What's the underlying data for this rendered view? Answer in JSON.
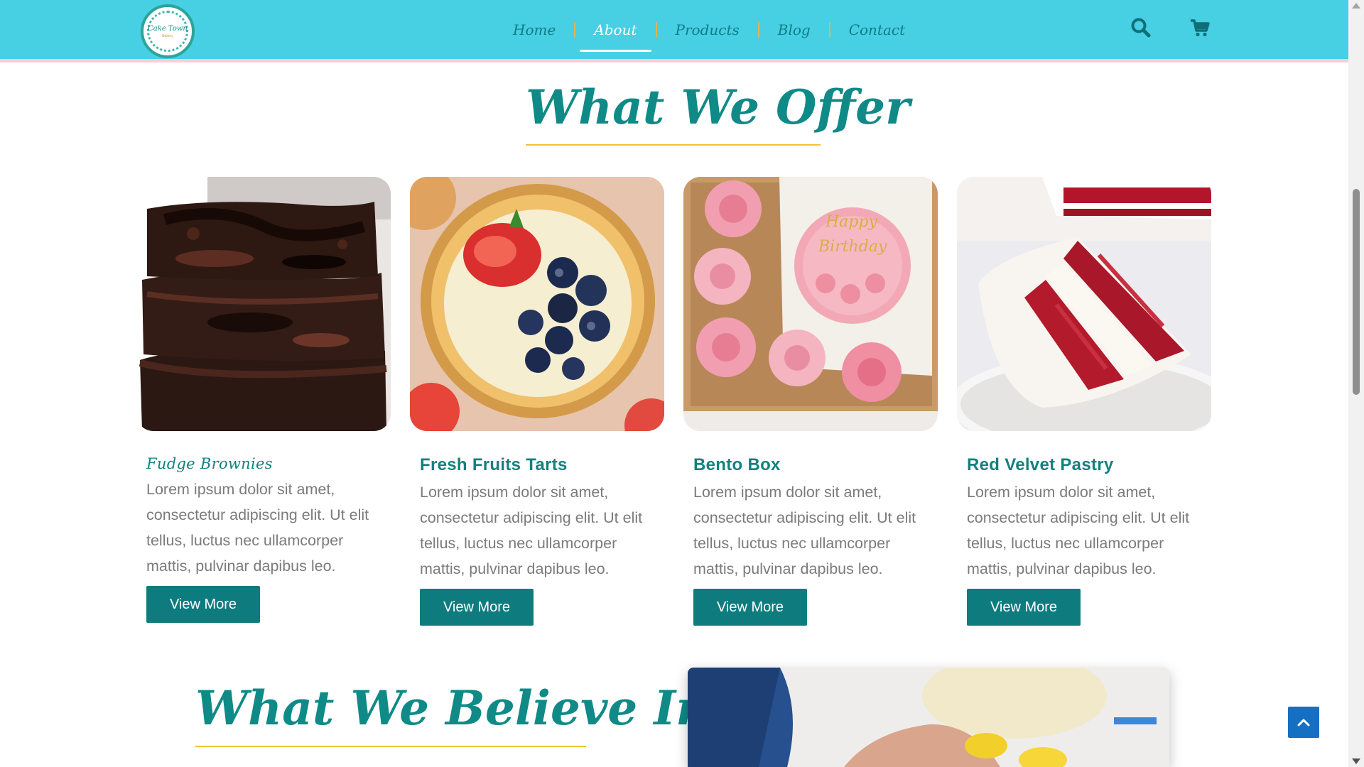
{
  "brand": {
    "logo_text": "Cake Town",
    "logo_sub": "Bakery",
    "colors": {
      "header": "#47cfe3",
      "accent": "#0e7c7f",
      "title": "#0f8a87",
      "underline": "#f0c332"
    }
  },
  "nav": {
    "items": [
      {
        "label": "Home",
        "active": false
      },
      {
        "label": "About",
        "active": true
      },
      {
        "label": "Products",
        "active": false
      },
      {
        "label": "Blog",
        "active": false
      },
      {
        "label": "Contact",
        "active": false
      }
    ],
    "icons": [
      "search-icon",
      "cart-icon"
    ]
  },
  "offer": {
    "title": "What We Offer",
    "cards": [
      {
        "name": "Fudge Brownies",
        "image": "brownies-image",
        "description": "Lorem ipsum dolor sit amet, consectetur adipiscing elit. Ut elit tellus, luctus nec ullamcorper mattis, pulvinar dapibus leo.",
        "button": "View More"
      },
      {
        "name": "Fresh Fruits Tarts",
        "image": "fruit-tart-image",
        "description": "Lorem ipsum dolor sit amet, consectetur adipiscing elit. Ut elit tellus, luctus nec ullamcorper mattis, pulvinar dapibus leo.",
        "button": "View More"
      },
      {
        "name": "Bento Box",
        "image": "bento-box-image",
        "description": "Lorem ipsum dolor sit amet, consectetur adipiscing elit. Ut elit tellus, luctus nec ullamcorper mattis, pulvinar dapibus leo.",
        "button": "View More"
      },
      {
        "name": "Red Velvet Pastry",
        "image": "red-velvet-image",
        "description": "Lorem ipsum dolor sit amet, consectetur adipiscing elit. Ut elit tellus, luctus nec ullamcorper mattis, pulvinar dapibus leo.",
        "button": "View More"
      }
    ]
  },
  "believe": {
    "title": "What We Believe In"
  },
  "scroll_top_icon": "chevron-up-icon"
}
